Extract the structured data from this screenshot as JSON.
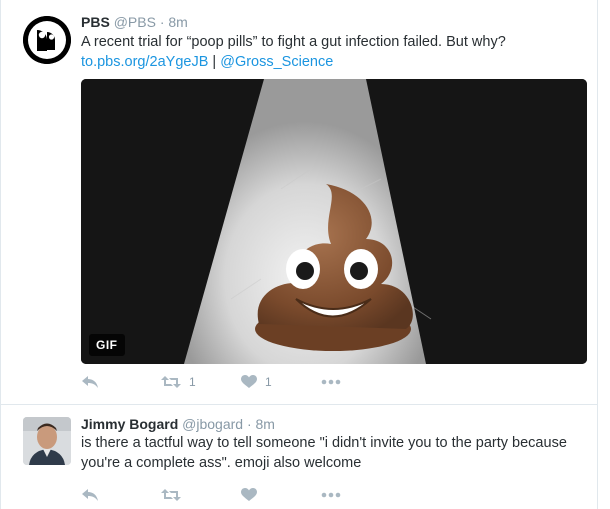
{
  "tweets": [
    {
      "name": "PBS",
      "handle": "@PBS",
      "dot": "·",
      "time": "8m",
      "text": "A recent trial for “poop pills” to fight a gut infection failed. But why?",
      "link1": "to.pbs.org/2aYgeJB",
      "sep": "|",
      "link2": "@Gross_Science",
      "media_badge": "GIF",
      "retweet_count": "1",
      "like_count": "1"
    },
    {
      "name": "Jimmy Bogard",
      "handle": "@jbogard",
      "dot": "·",
      "time": "8m",
      "text": "is there a tactful way to tell someone \"i didn't invite you to the party because you're a complete ass\". emoji also welcome"
    }
  ],
  "icons": [
    "pbs-logo-icon",
    "reply-icon",
    "retweet-icon",
    "heart-icon",
    "more-icon"
  ],
  "colors": {
    "link": "#1b95e0",
    "muted": "#8899a6",
    "action_icon": "#aab8c2",
    "text": "#292f33"
  }
}
